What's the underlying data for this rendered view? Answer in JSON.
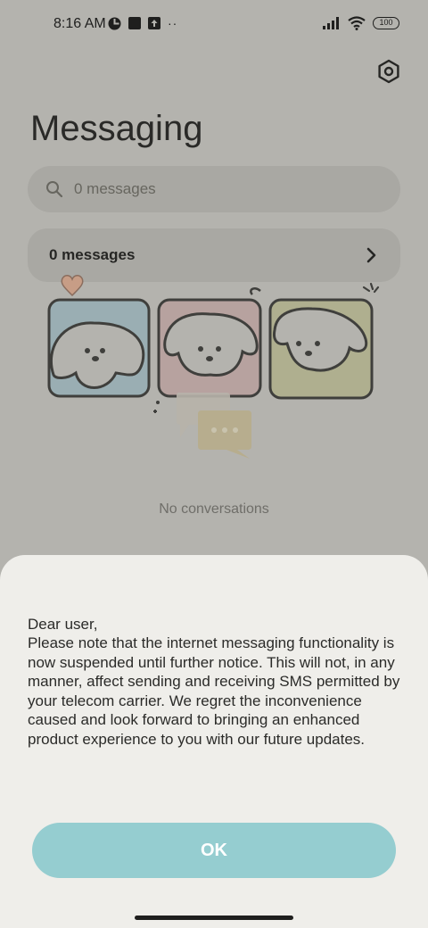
{
  "status_bar": {
    "time": "8:16 AM",
    "battery": "100",
    "overflow": "··"
  },
  "header": {
    "title": "Messaging",
    "settings_icon": "gear-hexagon-icon"
  },
  "search": {
    "placeholder": "0 messages"
  },
  "messages_row": {
    "label": "0 messages"
  },
  "empty_state": {
    "text": "No conversations"
  },
  "dialog": {
    "greeting": "Dear user,",
    "body": "Please note that the internet messaging functionality is now suspended until further notice. This will not, in any manner, affect sending and receiving SMS permitted by your telecom carrier. We regret the inconvenience caused and look forward to bringing an enhanced product experience to you with our future updates.",
    "ok_label": "OK",
    "ok_color": "#95cdd0"
  }
}
